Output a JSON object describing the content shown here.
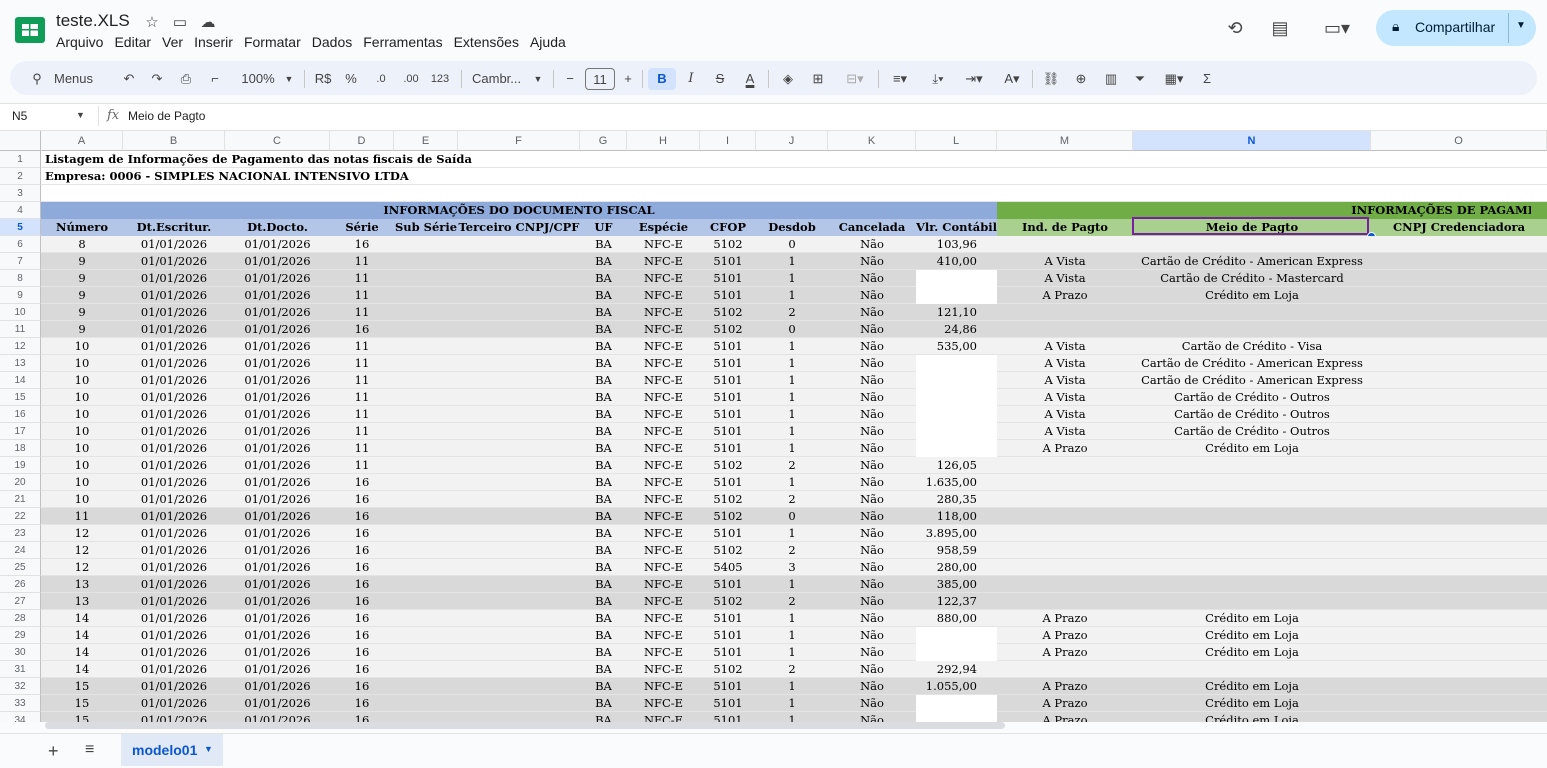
{
  "app": {
    "doc_title": "teste.XLS",
    "menu": [
      "Arquivo",
      "Editar",
      "Ver",
      "Inserir",
      "Formatar",
      "Dados",
      "Ferramentas",
      "Extensões",
      "Ajuda"
    ],
    "share_label": "Compartilhar",
    "accent": "#c2e7ff"
  },
  "toolbar": {
    "search_label": "Menus",
    "zoom": "100%",
    "currency": "R$",
    "percent": "%",
    "dec_less": ".0",
    "dec_more": ".00",
    "number_format": "123",
    "font": "Cambr...",
    "font_size": "11",
    "bold": "B",
    "italic": "I",
    "strike": "S",
    "text_color": "A",
    "sum": "Σ"
  },
  "formula": {
    "cell_ref": "N5",
    "fx": "fx",
    "value": "Meio de Pagto"
  },
  "columns": [
    "A",
    "B",
    "C",
    "D",
    "E",
    "F",
    "G",
    "H",
    "I",
    "J",
    "K",
    "L",
    "M",
    "N",
    "O"
  ],
  "selected_column": "N",
  "selected_row": "5",
  "colors": {
    "section_blue": "#8eaadb",
    "header_blue": "#b4c6e7",
    "section_green": "#70ad47",
    "header_green": "#a9d08e",
    "shade_light": "#f2f2f2",
    "shade_dark": "#d9d9d9",
    "selection": "#7b1fa2"
  },
  "sheet": {
    "title_line1": "Listagem de Informações de Pagamento das notas fiscais de Saída",
    "title_line2": "Empresa: 0006 - SIMPLES NACIONAL INTENSIVO LTDA",
    "section_doc": "INFORMAÇÕES DO DOCUMENTO FISCAL",
    "section_pag": "INFORMAÇÕES DE PAGAMEN",
    "headers": [
      "Número",
      "Dt.Escritur.",
      "Dt.Docto.",
      "Série",
      "Sub Série",
      "Terceiro CNPJ/CPF",
      "UF",
      "Espécie",
      "CFOP",
      "Desdob",
      "Cancelada",
      "Vlr. Contábil",
      "Ind. de Pagto",
      "Meio de Pagto",
      "CNPJ Credenciadora"
    ]
  },
  "rows": [
    {
      "n": "6",
      "shade": "light",
      "v": [
        "8",
        "01/01/2026",
        "01/01/2026",
        "16",
        "",
        "",
        "BA",
        "NFC-E",
        "5102",
        "0",
        "Não",
        "103,96",
        "",
        "",
        ""
      ]
    },
    {
      "n": "7",
      "shade": "dark",
      "v": [
        "9",
        "01/01/2026",
        "01/01/2026",
        "11",
        "",
        "",
        "BA",
        "NFC-E",
        "5101",
        "1",
        "Não",
        "410,00",
        "A Vista",
        "Cartão de Crédito - American Express",
        ""
      ]
    },
    {
      "n": "8",
      "shade": "dark",
      "v": [
        "9",
        "01/01/2026",
        "01/01/2026",
        "11",
        "",
        "",
        "BA",
        "NFC-E",
        "5101",
        "1",
        "Não",
        "",
        "A Vista",
        "Cartão de Crédito - Mastercard",
        ""
      ]
    },
    {
      "n": "9",
      "shade": "dark",
      "v": [
        "9",
        "01/01/2026",
        "01/01/2026",
        "11",
        "",
        "",
        "BA",
        "NFC-E",
        "5101",
        "1",
        "Não",
        "",
        "A Prazo",
        "Crédito em Loja",
        ""
      ]
    },
    {
      "n": "10",
      "shade": "dark",
      "v": [
        "9",
        "01/01/2026",
        "01/01/2026",
        "11",
        "",
        "",
        "BA",
        "NFC-E",
        "5102",
        "2",
        "Não",
        "121,10",
        "",
        "",
        ""
      ]
    },
    {
      "n": "11",
      "shade": "dark",
      "v": [
        "9",
        "01/01/2026",
        "01/01/2026",
        "16",
        "",
        "",
        "BA",
        "NFC-E",
        "5102",
        "0",
        "Não",
        "24,86",
        "",
        "",
        ""
      ]
    },
    {
      "n": "12",
      "shade": "light",
      "v": [
        "10",
        "01/01/2026",
        "01/01/2026",
        "11",
        "",
        "",
        "BA",
        "NFC-E",
        "5101",
        "1",
        "Não",
        "535,00",
        "A Vista",
        "Cartão de Crédito - Visa",
        ""
      ]
    },
    {
      "n": "13",
      "shade": "light",
      "v": [
        "10",
        "01/01/2026",
        "01/01/2026",
        "11",
        "",
        "",
        "BA",
        "NFC-E",
        "5101",
        "1",
        "Não",
        "",
        "A Vista",
        "Cartão de Crédito - American Express",
        ""
      ]
    },
    {
      "n": "14",
      "shade": "light",
      "v": [
        "10",
        "01/01/2026",
        "01/01/2026",
        "11",
        "",
        "",
        "BA",
        "NFC-E",
        "5101",
        "1",
        "Não",
        "",
        "A Vista",
        "Cartão de Crédito - American Express",
        ""
      ]
    },
    {
      "n": "15",
      "shade": "light",
      "v": [
        "10",
        "01/01/2026",
        "01/01/2026",
        "11",
        "",
        "",
        "BA",
        "NFC-E",
        "5101",
        "1",
        "Não",
        "",
        "A Vista",
        "Cartão de Crédito - Outros",
        ""
      ]
    },
    {
      "n": "16",
      "shade": "light",
      "v": [
        "10",
        "01/01/2026",
        "01/01/2026",
        "11",
        "",
        "",
        "BA",
        "NFC-E",
        "5101",
        "1",
        "Não",
        "",
        "A Vista",
        "Cartão de Crédito - Outros",
        ""
      ]
    },
    {
      "n": "17",
      "shade": "light",
      "v": [
        "10",
        "01/01/2026",
        "01/01/2026",
        "11",
        "",
        "",
        "BA",
        "NFC-E",
        "5101",
        "1",
        "Não",
        "",
        "A Vista",
        "Cartão de Crédito - Outros",
        ""
      ]
    },
    {
      "n": "18",
      "shade": "light",
      "v": [
        "10",
        "01/01/2026",
        "01/01/2026",
        "11",
        "",
        "",
        "BA",
        "NFC-E",
        "5101",
        "1",
        "Não",
        "",
        "A Prazo",
        "Crédito em Loja",
        ""
      ]
    },
    {
      "n": "19",
      "shade": "light",
      "v": [
        "10",
        "01/01/2026",
        "01/01/2026",
        "11",
        "",
        "",
        "BA",
        "NFC-E",
        "5102",
        "2",
        "Não",
        "126,05",
        "",
        "",
        ""
      ]
    },
    {
      "n": "20",
      "shade": "light",
      "v": [
        "10",
        "01/01/2026",
        "01/01/2026",
        "16",
        "",
        "",
        "BA",
        "NFC-E",
        "5101",
        "1",
        "Não",
        "1.635,00",
        "",
        "",
        ""
      ]
    },
    {
      "n": "21",
      "shade": "light",
      "v": [
        "10",
        "01/01/2026",
        "01/01/2026",
        "16",
        "",
        "",
        "BA",
        "NFC-E",
        "5102",
        "2",
        "Não",
        "280,35",
        "",
        "",
        ""
      ]
    },
    {
      "n": "22",
      "shade": "dark",
      "v": [
        "11",
        "01/01/2026",
        "01/01/2026",
        "16",
        "",
        "",
        "BA",
        "NFC-E",
        "5102",
        "0",
        "Não",
        "118,00",
        "",
        "",
        ""
      ]
    },
    {
      "n": "23",
      "shade": "light",
      "v": [
        "12",
        "01/01/2026",
        "01/01/2026",
        "16",
        "",
        "",
        "BA",
        "NFC-E",
        "5101",
        "1",
        "Não",
        "3.895,00",
        "",
        "",
        ""
      ]
    },
    {
      "n": "24",
      "shade": "light",
      "v": [
        "12",
        "01/01/2026",
        "01/01/2026",
        "16",
        "",
        "",
        "BA",
        "NFC-E",
        "5102",
        "2",
        "Não",
        "958,59",
        "",
        "",
        ""
      ]
    },
    {
      "n": "25",
      "shade": "light",
      "v": [
        "12",
        "01/01/2026",
        "01/01/2026",
        "16",
        "",
        "",
        "BA",
        "NFC-E",
        "5405",
        "3",
        "Não",
        "280,00",
        "",
        "",
        ""
      ]
    },
    {
      "n": "26",
      "shade": "dark",
      "v": [
        "13",
        "01/01/2026",
        "01/01/2026",
        "16",
        "",
        "",
        "BA",
        "NFC-E",
        "5101",
        "1",
        "Não",
        "385,00",
        "",
        "",
        ""
      ]
    },
    {
      "n": "27",
      "shade": "dark",
      "v": [
        "13",
        "01/01/2026",
        "01/01/2026",
        "16",
        "",
        "",
        "BA",
        "NFC-E",
        "5102",
        "2",
        "Não",
        "122,37",
        "",
        "",
        ""
      ]
    },
    {
      "n": "28",
      "shade": "light",
      "v": [
        "14",
        "01/01/2026",
        "01/01/2026",
        "16",
        "",
        "",
        "BA",
        "NFC-E",
        "5101",
        "1",
        "Não",
        "880,00",
        "A Prazo",
        "Crédito em Loja",
        ""
      ]
    },
    {
      "n": "29",
      "shade": "light",
      "v": [
        "14",
        "01/01/2026",
        "01/01/2026",
        "16",
        "",
        "",
        "BA",
        "NFC-E",
        "5101",
        "1",
        "Não",
        "",
        "A Prazo",
        "Crédito em Loja",
        ""
      ]
    },
    {
      "n": "30",
      "shade": "light",
      "v": [
        "14",
        "01/01/2026",
        "01/01/2026",
        "16",
        "",
        "",
        "BA",
        "NFC-E",
        "5101",
        "1",
        "Não",
        "",
        "A Prazo",
        "Crédito em Loja",
        ""
      ]
    },
    {
      "n": "31",
      "shade": "light",
      "v": [
        "14",
        "01/01/2026",
        "01/01/2026",
        "16",
        "",
        "",
        "BA",
        "NFC-E",
        "5102",
        "2",
        "Não",
        "292,94",
        "",
        "",
        ""
      ]
    },
    {
      "n": "32",
      "shade": "dark",
      "v": [
        "15",
        "01/01/2026",
        "01/01/2026",
        "16",
        "",
        "",
        "BA",
        "NFC-E",
        "5101",
        "1",
        "Não",
        "1.055,00",
        "A Prazo",
        "Crédito em Loja",
        ""
      ]
    },
    {
      "n": "33",
      "shade": "dark",
      "v": [
        "15",
        "01/01/2026",
        "01/01/2026",
        "16",
        "",
        "",
        "BA",
        "NFC-E",
        "5101",
        "1",
        "Não",
        "",
        "A Prazo",
        "Crédito em Loja",
        ""
      ]
    },
    {
      "n": "34",
      "shade": "dark",
      "v": [
        "15",
        "01/01/2026",
        "01/01/2026",
        "16",
        "",
        "",
        "BA",
        "NFC-E",
        "5101",
        "1",
        "Não",
        "",
        "A Prazo",
        "Crédito em Loja",
        ""
      ]
    }
  ],
  "sheet_tabs": {
    "active": "modelo01"
  }
}
